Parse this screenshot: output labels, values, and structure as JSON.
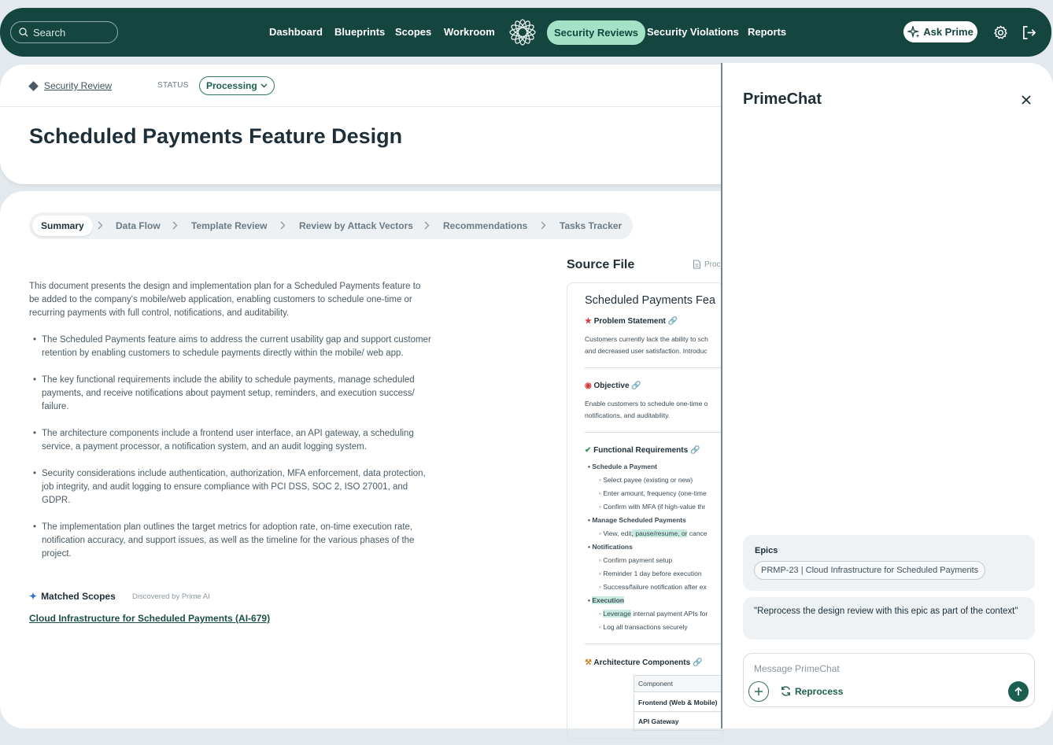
{
  "nav": {
    "search_placeholder": "Search",
    "links": [
      "Dashboard",
      "Blueprints",
      "Scopes",
      "Workroom",
      "Security Reviews",
      "Security Violations",
      "Reports"
    ],
    "active_link": "Security Reviews",
    "ask_label": "Ask Prime",
    "icons": [
      "search-icon",
      "logo-icon",
      "sparkle-icon",
      "gear-icon",
      "logout-icon"
    ]
  },
  "header": {
    "breadcrumb": "Security Review",
    "status_label": "STATUS",
    "status_value": "Processing",
    "title": "Scheduled Payments Feature Design"
  },
  "tabs": [
    "Summary",
    "Data Flow",
    "Template Review",
    "Review by Attack Vectors",
    "Recommendations",
    "Tasks Tracker"
  ],
  "summary": {
    "intro": "This document presents the design and implementation plan for a Scheduled Payments feature to be added to the company's mobile/web application, enabling customers to schedule one-time or recurring payments with full control, notifications, and auditability.",
    "bullets": [
      "The Scheduled Payments feature aims to address the current usability gap and support customer retention by enabling customers to schedule payments directly within the mobile/ web app.",
      "The key functional requirements include the ability to schedule payments, manage scheduled payments, and receive notifications about payment setup, reminders, and execution success/ failure.",
      "The architecture components include a frontend user interface, an API gateway, a scheduling service, a payment processor, a notification system, and an audit logging system.",
      "Security considerations include authentication, authorization, MFA enforcement, data protection, job integrity, and audit logging to ensure compliance with PCI DSS, SOC 2, ISO 27001, and GDPR.",
      "The implementation plan outlines the target metrics for adoption rate, on-time execution rate, notification accuracy, and support issues, as well as the timeline for the various phases of the project."
    ],
    "matched_scopes_title": "Matched Scopes",
    "matched_scopes_sub": "Discovered by Prime AI",
    "scope_link": "Cloud Infrastructure for Scheduled Payments (AI-679)"
  },
  "source": {
    "title": "Source File",
    "proc_label": "Proc",
    "doc_title": "Scheduled Payments Fea",
    "problem_title": "Problem Statement",
    "problem_lines": [
      "Customers currently lack the ability to sch",
      "and decreased user satisfaction. Introduc"
    ],
    "objective_title": "Objective",
    "objective_lines": [
      "Enable customers to schedule one-time o",
      "notifications, and auditability."
    ],
    "func_title": "Functional Requirements",
    "schedule_title": "Schedule a Payment",
    "schedule_items": [
      "Select payee (existing or new)",
      "Enter amount, frequency (one-time",
      "Confirm with MFA (if high-value thr"
    ],
    "manage_title": "Manage Scheduled Payments",
    "manage_item_a": "View, edit",
    "manage_item_hl": ", pause/resume, or",
    "manage_item_b": " cance",
    "notif_title": "Notifications",
    "notif_items": [
      "Confirm payment setup",
      "Reminder 1 day before execution",
      "Success/failure notification after ex"
    ],
    "exec_title": "Execution",
    "exec_item_hl": "Leverage",
    "exec_item_rest": " internal payment APIs for",
    "exec_item_2": "Log all transactions securely",
    "arch_title": "Architecture Components",
    "table_header": "Component",
    "table_rows": [
      "Frontend (Web & Mobile)",
      "API Gateway"
    ]
  },
  "chat": {
    "title": "PrimeChat",
    "epics_label": "Epics",
    "epic_chip": "PRMP-23 | Cloud Infrastructure for Scheduled Payments",
    "message": "\"Reprocess the design review with this epic as part of the context\"",
    "input_placeholder": "Message PrimeChat",
    "reprocess_label": "Reprocess"
  },
  "colors": {
    "nav_bg": "#14463f",
    "active_pill": "#a4e2c8",
    "accent": "#1c5f50"
  }
}
